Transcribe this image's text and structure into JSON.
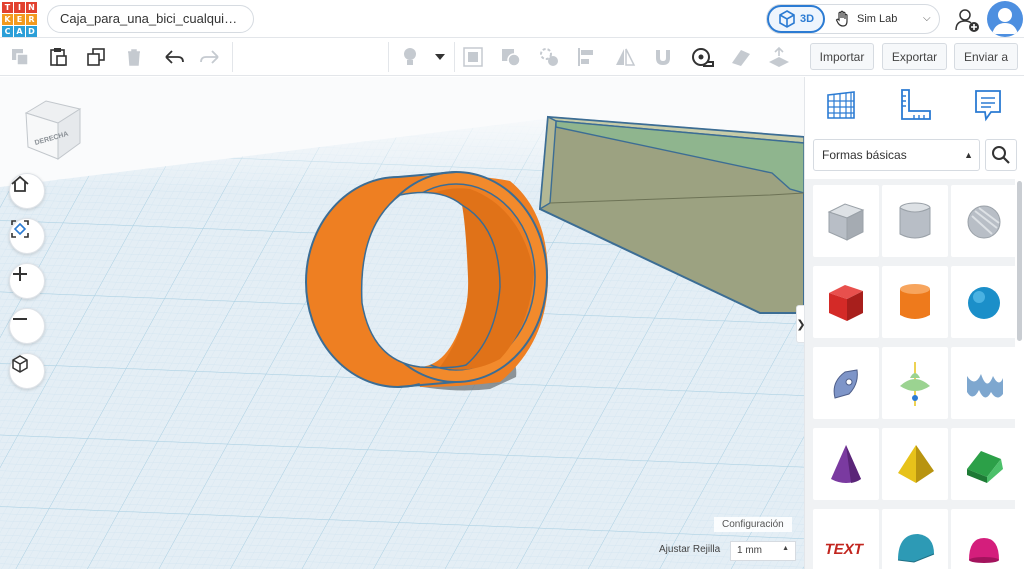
{
  "app": {
    "logo_letters": [
      "T",
      "I",
      "N",
      "K",
      "E",
      "R",
      "C",
      "A",
      "D"
    ],
    "logo_colors": [
      "#e2412f",
      "#e2412f",
      "#e2412f",
      "#f39a1e",
      "#f39a1e",
      "#f39a1e",
      "#2b9fd8",
      "#2b9fd8",
      "#2b9fd8"
    ],
    "design_title": "Caja_para_una_bici_cualqui…"
  },
  "mode": {
    "active_label": "3D",
    "sim_label": "Sim Lab"
  },
  "toolbar": {
    "items": [
      "copy-icon",
      "paste-icon",
      "duplicate-icon",
      "delete-icon",
      "undo-icon",
      "redo-icon",
      "light-icon",
      "dropdown-icon",
      "hole-icon",
      "group-icon",
      "ungroup-icon",
      "align-icon",
      "mirror-icon",
      "magnet-icon",
      "ruler-icon",
      "note-icon",
      "workplane-icon"
    ]
  },
  "actions": {
    "import_label": "Importar",
    "export_label": "Exportar",
    "send_label": "Enviar a"
  },
  "viewcube": {
    "face_label": "DERECHA"
  },
  "workplane": {
    "config_label": "Configuración",
    "grid_label": "Ajustar Rejilla",
    "grid_value": "1 mm"
  },
  "panel": {
    "tabs": [
      "workplane-grid-icon",
      "ruler-tool-icon",
      "notes-icon"
    ],
    "shape_category": "Formas básicas",
    "shapes": [
      {
        "name": "box-hole",
        "color": "#b8bec6"
      },
      {
        "name": "cylinder-hole",
        "color": "#b8bec6"
      },
      {
        "name": "sphere-hole",
        "color": "#b8bec6"
      },
      {
        "name": "box",
        "color": "#d42a27"
      },
      {
        "name": "cylinder",
        "color": "#ee7a1c"
      },
      {
        "name": "sphere",
        "color": "#1b8fc9"
      },
      {
        "name": "scribble",
        "color": "#7e95c8"
      },
      {
        "name": "shape-generator",
        "color": "#9bd391"
      },
      {
        "name": "text-wave",
        "color": "#7ea7cf"
      },
      {
        "name": "cone",
        "color": "#7a3aa0"
      },
      {
        "name": "pyramid",
        "color": "#e7c21a"
      },
      {
        "name": "roof",
        "color": "#2ca048"
      },
      {
        "name": "text",
        "color": "#c2261f"
      },
      {
        "name": "half-cylinder",
        "color": "#2d9ab5"
      },
      {
        "name": "half-sphere",
        "color": "#d41e7c"
      }
    ]
  },
  "colors": {
    "accent": "#2b7bd3",
    "ring": "#ee7f22",
    "box": "#9aa07c",
    "box_inner": "#8fb58e",
    "grid": "#c6dcea"
  }
}
